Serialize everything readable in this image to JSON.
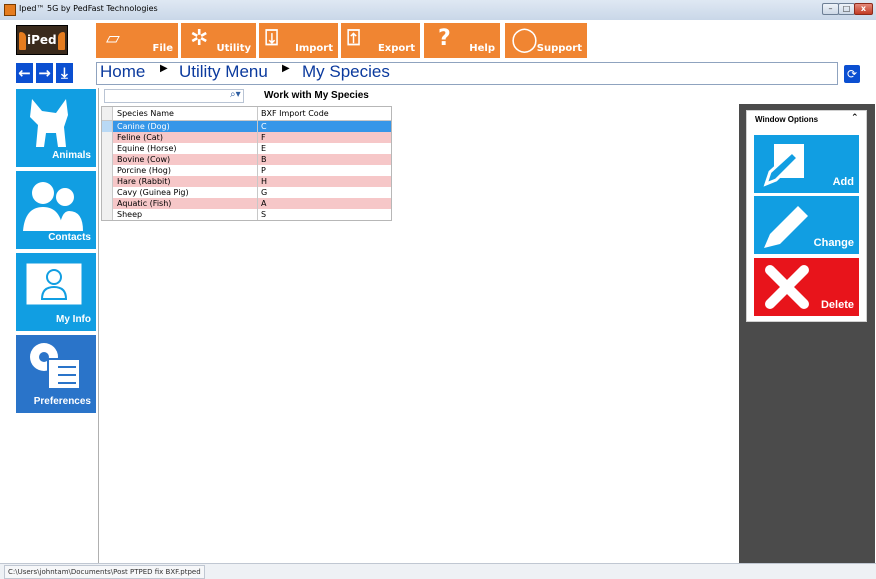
{
  "window": {
    "title": "Iped™ 5G by PedFast Technologies"
  },
  "logo": {
    "text": "iPed"
  },
  "toolbar": [
    {
      "name": "file",
      "label": "File",
      "icon": "file-icon"
    },
    {
      "name": "utility",
      "label": "Utility",
      "icon": "gear-icon"
    },
    {
      "name": "import",
      "label": "Import",
      "icon": "import-icon"
    },
    {
      "name": "export",
      "label": "Export",
      "icon": "export-icon"
    },
    {
      "name": "help",
      "label": "Help",
      "icon": "question-icon"
    },
    {
      "name": "support",
      "label": "Support",
      "icon": "lifebuoy-icon"
    }
  ],
  "breadcrumb": [
    "Home",
    "Utility Menu",
    "My Species"
  ],
  "sidebar": [
    {
      "label": "Animals",
      "icon": "dog-icon"
    },
    {
      "label": "Contacts",
      "icon": "people-icon"
    },
    {
      "label": "My Info",
      "icon": "person-card-icon"
    },
    {
      "label": "Preferences",
      "icon": "settings-list-icon"
    }
  ],
  "grid": {
    "title": "Work with My Species",
    "columns": [
      "Species Name",
      "BXF Import Code"
    ],
    "rows": [
      {
        "name": "Canine (Dog)",
        "code": "C"
      },
      {
        "name": "Feline (Cat)",
        "code": "F"
      },
      {
        "name": "Equine (Horse)",
        "code": "E"
      },
      {
        "name": "Bovine (Cow)",
        "code": "B"
      },
      {
        "name": "Porcine (Hog)",
        "code": "P"
      },
      {
        "name": "Hare (Rabbit)",
        "code": "H"
      },
      {
        "name": "Cavy (Guinea Pig)",
        "code": "G"
      },
      {
        "name": "Aquatic (Fish)",
        "code": "A"
      },
      {
        "name": "Sheep",
        "code": "S"
      }
    ],
    "selected_index": 0
  },
  "window_options": {
    "title": "Window Options",
    "actions": [
      {
        "label": "Add",
        "color": "#119ee2"
      },
      {
        "label": "Change",
        "color": "#119ee2"
      },
      {
        "label": "Delete",
        "color": "#e8141b"
      }
    ]
  },
  "statusbar": {
    "path": "C:\\Users\\johntam\\Documents\\Post PTPED fix BXF.ptped"
  },
  "colors": {
    "accent_orange": "#f08532",
    "tile_blue": "#119ee2",
    "nav_blue": "#0b4fd1",
    "delete_red": "#e8141b",
    "row_alt": "#f6c7c8",
    "row_selected": "#3596e8"
  }
}
